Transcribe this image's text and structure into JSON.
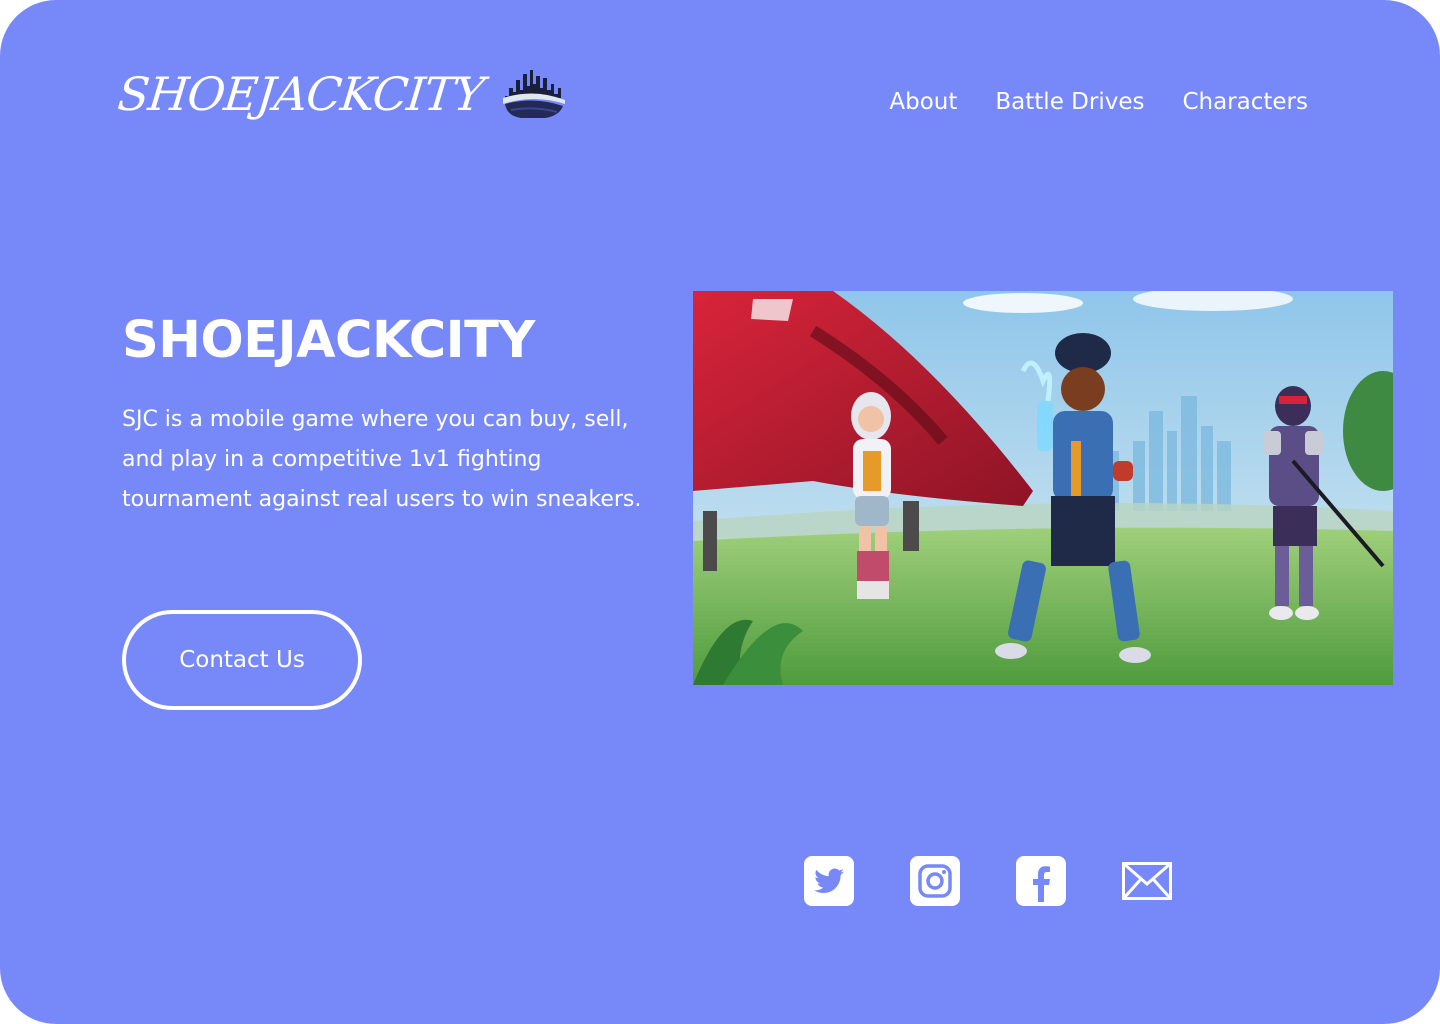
{
  "header": {
    "logo_text": "SHOEJACKCITY",
    "logo_icon": "city-skyline-sneaker-icon",
    "nav": [
      {
        "label": "About"
      },
      {
        "label": "Battle Drives"
      },
      {
        "label": "Characters"
      }
    ]
  },
  "hero": {
    "title": "SHOEJACKCITY",
    "description": "SJC is a mobile game where you can buy, sell, and play in a competitive 1v1 fighting tournament against real users to win sneakers.",
    "cta_label": "Contact Us"
  },
  "illustration": {
    "subject": "watercolor illustration of three characters on a grassy field beside a red ship, with a blue city skyline behind"
  },
  "social": {
    "items": [
      {
        "icon": "twitter-icon"
      },
      {
        "icon": "instagram-icon"
      },
      {
        "icon": "facebook-icon"
      },
      {
        "icon": "mail-icon"
      }
    ]
  },
  "colors": {
    "background": "#7789f9",
    "text": "#ffffff"
  }
}
